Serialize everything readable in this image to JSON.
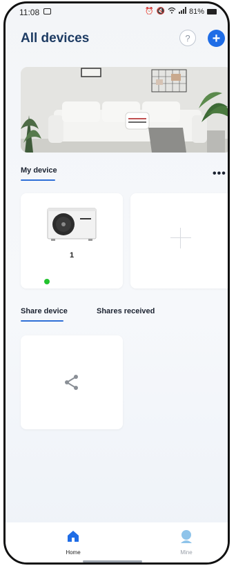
{
  "status_bar": {
    "time": "11:08",
    "right_text": "81%"
  },
  "header": {
    "title": "All devices",
    "help_label": "?",
    "add_label": "+"
  },
  "my_device": {
    "label": "My device",
    "more_label": "•••",
    "devices": [
      {
        "name": "1",
        "online": true
      }
    ]
  },
  "share": {
    "tabs": [
      {
        "label": "Share device",
        "active": true
      },
      {
        "label": "Shares received",
        "active": false
      }
    ]
  },
  "bottom_nav": {
    "items": [
      {
        "label": "Home",
        "icon": "home-icon",
        "active": true
      },
      {
        "label": "Mine",
        "icon": "profile-icon",
        "active": false
      }
    ]
  },
  "colors": {
    "accent": "#1f6de6",
    "title": "#1d3b63",
    "online": "#22c32e"
  }
}
